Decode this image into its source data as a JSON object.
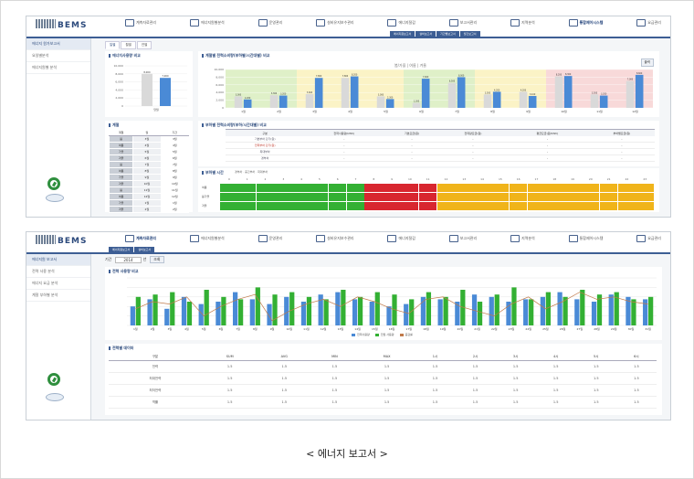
{
  "caption": "< 에너지 보고서 >",
  "logo": "BEMS",
  "colors": {
    "accent": "#3d5e94",
    "bar_blue": "#4a8ad6",
    "bar_gray": "#d9d9d9",
    "green": "#33b033",
    "red": "#d8262f",
    "orange": "#f0b41a",
    "line": "#c07a4a",
    "zone_green": "#dff0c8",
    "zone_yellow": "#fbf3c6",
    "zone_red": "#f8d9d9"
  },
  "screen1": {
    "menu": [
      "계측자료관리",
      "에너지원별분석",
      "운영관리",
      "설비유지보수관리",
      "에너지절감",
      "보고서관리",
      "지역분석",
      "통합제어시스템",
      "요금관리"
    ],
    "subtabs": [
      "에너지원보고서",
      "설비보고서",
      "기간별보고서",
      "월간보고서"
    ],
    "leftnav": [
      "에너지 원가보고서",
      "요일별분석",
      "에너지원별 분석"
    ],
    "content_tabs": [
      "일별",
      "월별",
      "연별"
    ],
    "btn_print": "출력",
    "panel_usage_title": "에너지사용량 비교",
    "panel_zone_title": "계절별 전력소비량(부하별/시간대별) 비교",
    "panel_zone_legend": "봄/가을 | 여름 | 겨울",
    "panel_season_title": "계절",
    "panel_table_title": "부하별 전력소비량(부하/시간대별) 비교",
    "panel_time_title": "부하별 시간",
    "time_legend": "경부하 · 중간부하 · 최대부하",
    "season_table": {
      "headers": [
        "계절",
        "월",
        "기간"
      ],
      "rows": [
        [
          "봄",
          "3월",
          "3월"
        ],
        [
          "여름",
          "4월",
          "4월"
        ],
        [
          "가을",
          "5월",
          "5월"
        ],
        [
          "겨울",
          "6월",
          "6월"
        ],
        [
          "봄",
          "7월",
          "7월"
        ],
        [
          "여름",
          "8월",
          "8월"
        ],
        [
          "가을",
          "9월",
          "9월"
        ],
        [
          "겨울",
          "10월",
          "10월"
        ],
        [
          "봄",
          "11월",
          "11월"
        ],
        [
          "여름",
          "12월",
          "12월"
        ],
        [
          "가을",
          "1월",
          "1월"
        ],
        [
          "겨울",
          "2월",
          "2월"
        ]
      ]
    },
    "load_table": {
      "headers": [
        "구분",
        "전력사용량(kWh)",
        "기본요금(원)",
        "전력량요금(원)",
        "평균요금(원/kWh)",
        "부하별요금(원)"
      ],
      "rows": [
        [
          "기본부하 단가(원)",
          "-",
          "-",
          "-",
          "-",
          "-"
        ],
        [
          "전력부하 단가(원)",
          "-",
          "-",
          "-",
          "-",
          "-"
        ],
        [
          "최대부하",
          "-",
          "-",
          "-",
          "-",
          "-"
        ],
        [
          "경부하",
          "-",
          "-",
          "-",
          "-",
          "-"
        ]
      ]
    },
    "time_rows": [
      "여름",
      "봄가을",
      "겨울"
    ],
    "time_hours": [
      "0",
      "1",
      "2",
      "3",
      "4",
      "5",
      "6",
      "7",
      "8",
      "9",
      "10",
      "11",
      "12",
      "13",
      "14",
      "15",
      "16",
      "17",
      "18",
      "19",
      "20",
      "21",
      "22",
      "23"
    ]
  },
  "screen2": {
    "menu": [
      "계측자료관리",
      "에너지원별분석",
      "운영관리",
      "설비유지보수관리",
      "에너지절감",
      "보고서관리",
      "지역분석",
      "통합제어시스템",
      "요금관리"
    ],
    "subtabs": [
      "에너지원보고서",
      "설비보고서"
    ],
    "leftnav": [
      "에너지원 보고서",
      "전력 사용 분석",
      "에너지 요금 분석",
      "계절 부하별 분석"
    ],
    "filters": {
      "label": "기간",
      "value": "2014",
      "unit": "년",
      "btn": "조회"
    },
    "chart_title": "전력 사용량 비교",
    "table_title": "전력별 데이터",
    "legend": [
      "전력사용량",
      "전월 사용량",
      "증감률"
    ],
    "table": {
      "headers": [
        "구분",
        "SUM",
        "AVG",
        "MIN",
        "MAX",
        "1시",
        "2시",
        "3시",
        "4시",
        "5시",
        "6시"
      ],
      "rows": [
        [
          "전력",
          "1.5",
          "1.5",
          "1.5",
          "1.5",
          "1.5",
          "1.5",
          "1.5",
          "1.5",
          "1.5",
          "1.5"
        ],
        [
          "최대전력",
          "1.5",
          "1.5",
          "1.5",
          "1.5",
          "1.5",
          "1.5",
          "1.5",
          "1.5",
          "1.5",
          "1.5"
        ],
        [
          "최저전력",
          "1.5",
          "1.5",
          "1.5",
          "1.5",
          "1.5",
          "1.5",
          "1.5",
          "1.5",
          "1.5",
          "1.5"
        ],
        [
          "역률",
          "1.5",
          "1.5",
          "1.5",
          "1.5",
          "1.5",
          "1.5",
          "1.5",
          "1.5",
          "1.5",
          "1.5"
        ]
      ]
    }
  },
  "chart_data": [
    {
      "type": "bar",
      "categories": [
        "전년동월",
        "당월"
      ],
      "values": [
        8000,
        7000
      ],
      "ylim": [
        0,
        10000
      ]
    },
    {
      "type": "bar",
      "categories": [
        "1월",
        "2월",
        "3월",
        "4월",
        "5월",
        "6월",
        "7월",
        "8월",
        "9월",
        "10월",
        "11월",
        "12월"
      ],
      "series": [
        {
          "values": [
            3000,
            3300,
            3600,
            7800,
            3000,
            1300,
            6500,
            3500,
            4200,
            8200,
            3500,
            7000
          ]
        },
        {
          "values": [
            2200,
            3200,
            7800,
            8200,
            2300,
            7600,
            8000,
            4200,
            3100,
            8300,
            3200,
            8600
          ]
        }
      ],
      "ylim": [
        0,
        10000
      ]
    },
    {
      "type": "bar",
      "categories": [
        "1일",
        "2일",
        "3일",
        "4일",
        "5일",
        "6일",
        "7일",
        "8일",
        "9일",
        "10일",
        "11일",
        "12일",
        "13일",
        "14일",
        "15일",
        "16일",
        "17일",
        "18일",
        "19일",
        "20일",
        "21일",
        "22일",
        "23일",
        "24일",
        "25일",
        "26일",
        "27일",
        "28일",
        "29일",
        "30일",
        "31일"
      ],
      "series": [
        {
          "name": "전력사용량",
          "values": [
            40,
            55,
            35,
            60,
            45,
            50,
            70,
            55,
            45,
            60,
            50,
            65,
            70,
            55,
            50,
            40,
            45,
            60,
            55,
            50,
            65,
            60,
            50,
            55,
            60,
            70,
            55,
            50,
            65,
            60,
            55
          ]
        },
        {
          "name": "전월 사용량",
          "values": [
            60,
            65,
            70,
            50,
            75,
            60,
            55,
            80,
            65,
            70,
            60,
            55,
            75,
            60,
            70,
            65,
            55,
            70,
            60,
            75,
            50,
            65,
            80,
            55,
            70,
            60,
            75,
            65,
            70,
            55,
            60
          ]
        },
        {
          "name": "증감률",
          "values": [
            35,
            50,
            45,
            60,
            20,
            40,
            55,
            65,
            10,
            30,
            45,
            55,
            40,
            60,
            50,
            35,
            25,
            55,
            60,
            40,
            30,
            20,
            45,
            60,
            35,
            50,
            70,
            55,
            60,
            50,
            45
          ]
        }
      ]
    }
  ]
}
